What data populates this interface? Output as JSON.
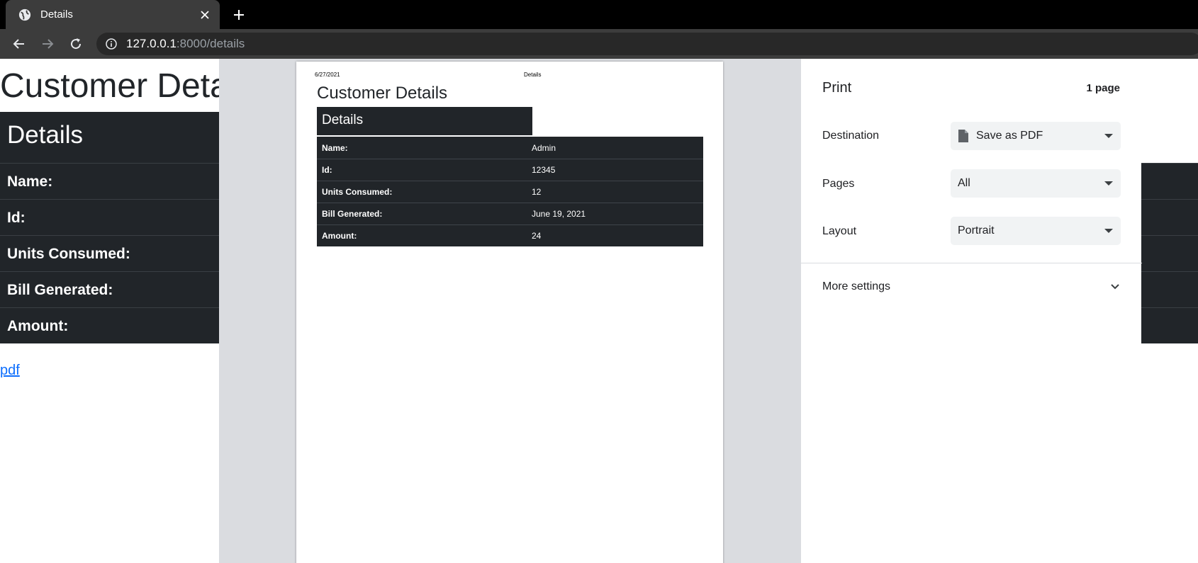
{
  "browser": {
    "tab_title": "Details",
    "url_host": "127.0.0.1",
    "url_rest": ":8000/details"
  },
  "page": {
    "heading": "Customer Details",
    "details_header": "Details",
    "rows": [
      {
        "label": "Name:"
      },
      {
        "label": "Id:"
      },
      {
        "label": "Units Consumed:"
      },
      {
        "label": "Bill Generated:"
      },
      {
        "label": "Amount:"
      }
    ],
    "link_text": "pdf"
  },
  "preview": {
    "header_date": "6/27/2021",
    "header_title": "Details",
    "heading": "Customer Details",
    "details_header": "Details",
    "rows": [
      {
        "label": "Name:",
        "value": "Admin"
      },
      {
        "label": "Id:",
        "value": "12345"
      },
      {
        "label": "Units Consumed:",
        "value": "12"
      },
      {
        "label": "Bill Generated:",
        "value": "June 19, 2021"
      },
      {
        "label": "Amount:",
        "value": "24"
      }
    ]
  },
  "print": {
    "title": "Print",
    "page_count": "1 page",
    "destination_label": "Destination",
    "destination_value": "Save as PDF",
    "pages_label": "Pages",
    "pages_value": "All",
    "layout_label": "Layout",
    "layout_value": "Portrait",
    "more_settings": "More settings"
  },
  "colors": {
    "dark": "#212529",
    "chrome": "#3c3c3c",
    "link": "#0d6efd"
  }
}
